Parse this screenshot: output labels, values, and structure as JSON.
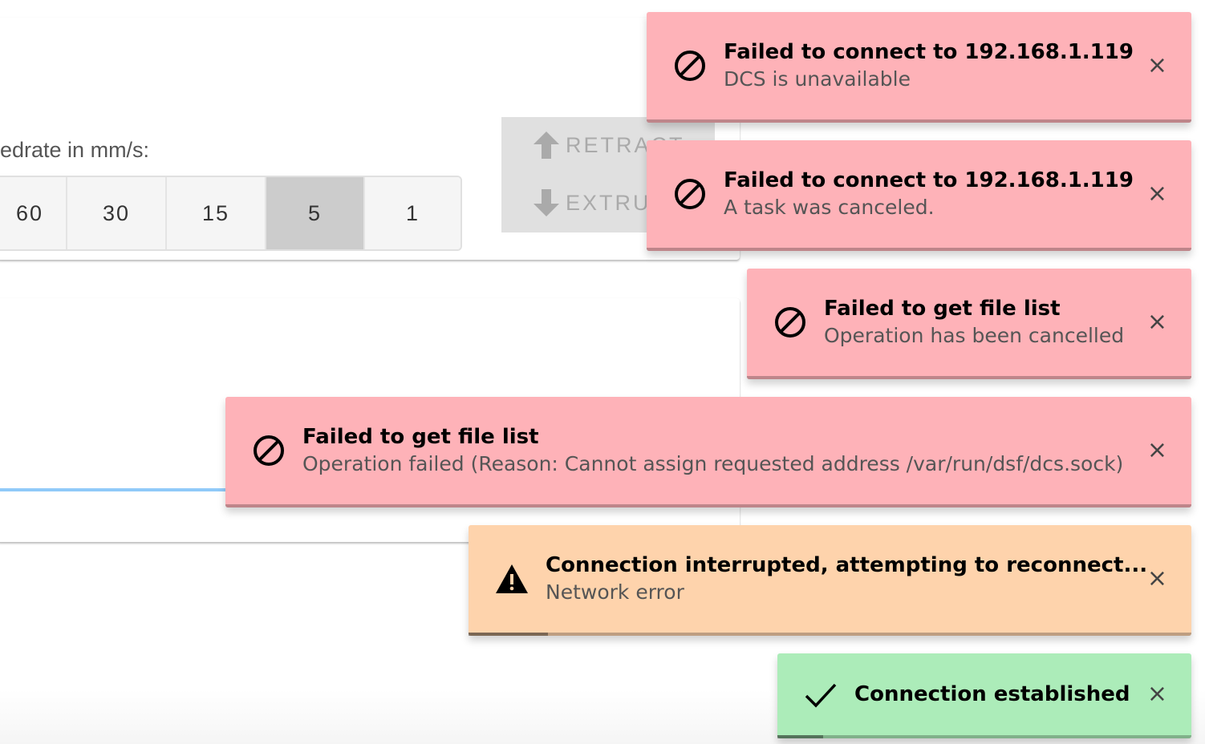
{
  "feedrate": {
    "label": "edrate in mm/s:",
    "options": [
      "60",
      "30",
      "15",
      "5",
      "1"
    ],
    "selected": "5"
  },
  "extrusion": {
    "retract_label": "RETRACT",
    "extrude_label": "EXTRUDE"
  },
  "toasts": [
    {
      "type": "error",
      "icon": "ban-icon",
      "title": "Failed to connect to 192.168.1.119",
      "message": "DCS is unavailable"
    },
    {
      "type": "error",
      "icon": "ban-icon",
      "title": "Failed to connect to 192.168.1.119",
      "message": "A task was canceled."
    },
    {
      "type": "error",
      "icon": "ban-icon",
      "title": "Failed to get file list",
      "message": "Operation has been cancelled"
    },
    {
      "type": "error",
      "icon": "ban-icon",
      "title": "Failed to get file list",
      "message": "Operation failed (Reason: Cannot assign requested address /var/run/dsf/dcs.sock)"
    },
    {
      "type": "warning",
      "icon": "warning-icon",
      "title": "Connection interrupted, attempting to reconnect...",
      "message": "Network error",
      "progress": 0.11
    },
    {
      "type": "success",
      "icon": "check-icon",
      "title": "Connection established",
      "message": "",
      "progress": 0.11
    }
  ],
  "close_glyph": "×",
  "colors": {
    "error": "#feb2b8",
    "warning": "#fed3ac",
    "success": "#acecb9",
    "selected": "#cccccc"
  }
}
